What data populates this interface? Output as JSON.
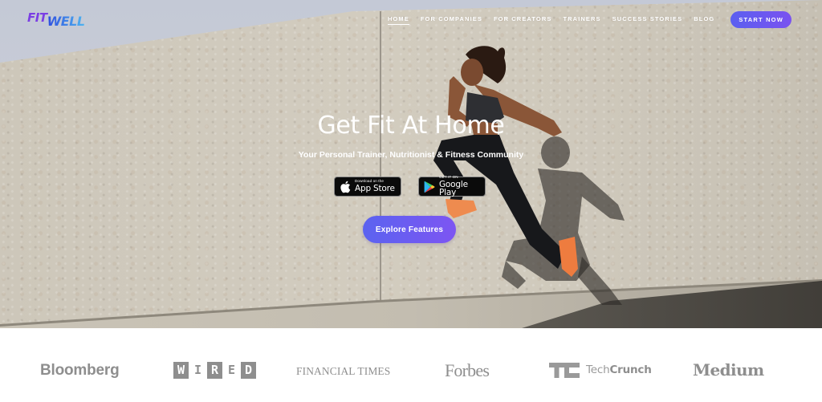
{
  "brand": {
    "logo_part1": "FIT",
    "logo_part2": "WELL",
    "accent_purple": "#7b3fe4",
    "accent_blue": "#2f4fe0",
    "cta_gradient_start": "#5b63f0",
    "cta_gradient_end": "#7d55f2"
  },
  "nav": {
    "items": [
      {
        "label": "HOME",
        "active": true
      },
      {
        "label": "FOR COMPANIES",
        "active": false
      },
      {
        "label": "FOR CREATORS",
        "active": false
      },
      {
        "label": "TRAINERS",
        "active": false
      },
      {
        "label": "SUCCESS STORIES",
        "active": false
      },
      {
        "label": "BLOG",
        "active": false
      }
    ],
    "cta_label": "START NOW"
  },
  "hero": {
    "title": "Get Fit At Home",
    "subtitle": "Your Personal Trainer, Nutritionist & Fitness Community",
    "app_store": {
      "small": "Download on the",
      "big": "App Store",
      "icon": "apple-icon"
    },
    "google_play": {
      "small": "GET IT ON",
      "big": "Google Play",
      "icon": "google-play-icon"
    },
    "explore_label": "Explore Features",
    "image": "woman-running-jump-against-concrete-wall"
  },
  "press": {
    "bloomberg": "Bloomberg",
    "wired_letters": [
      "W",
      "I",
      "R",
      "E",
      "D"
    ],
    "financial_times": "FINANCIAL TIMES",
    "forbes": "Forbes",
    "techcrunch_light": "Tech",
    "techcrunch_bold": "Crunch",
    "medium": "Medium"
  }
}
